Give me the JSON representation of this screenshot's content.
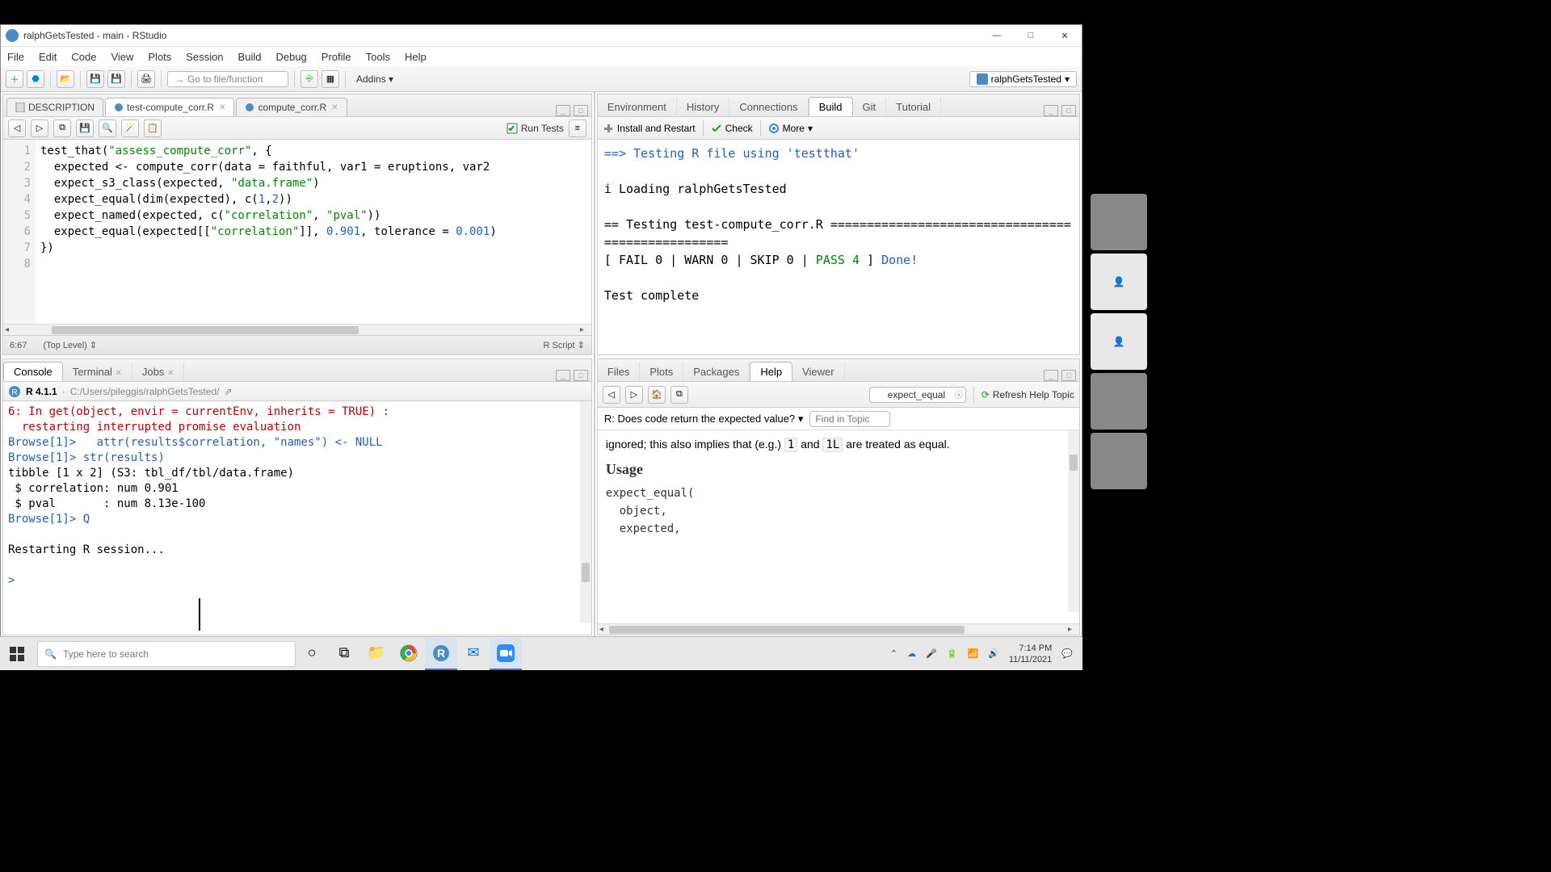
{
  "window": {
    "title": "ralphGetsTested - main - RStudio"
  },
  "menubar": [
    "File",
    "Edit",
    "Code",
    "View",
    "Plots",
    "Session",
    "Build",
    "Debug",
    "Profile",
    "Tools",
    "Help"
  ],
  "toolbar": {
    "goto_placeholder": "Go to file/function",
    "addins_label": "Addins",
    "project_label": "ralphGetsTested"
  },
  "source_tabs": [
    {
      "label": "DESCRIPTION",
      "active": false,
      "closable": false
    },
    {
      "label": "test-compute_corr.R",
      "active": true,
      "closable": true
    },
    {
      "label": "compute_corr.R",
      "active": false,
      "closable": true
    }
  ],
  "source_toolbar": {
    "runtests": "Run Tests"
  },
  "code_lines": {
    "l1_a": "test_that(",
    "l1_b": "\"assess_compute_corr\"",
    "l1_c": ", {",
    "l2_a": "  expected <- compute_corr(data = faithful, var1 = eruptions, var2",
    "l3_a": "  expect_s3_class(expected, ",
    "l3_b": "\"data.frame\"",
    "l3_c": ")",
    "l4_a": "  expect_equal(dim(expected), c(",
    "l4_b": "1",
    "l4_c": ",",
    "l4_d": "2",
    "l4_e": "))",
    "l5_a": "  expect_named(expected, c(",
    "l5_b": "\"correlation\"",
    "l5_c": ", ",
    "l5_d": "\"pval\"",
    "l5_e": "))",
    "l6_a": "  expect_equal(expected[[",
    "l6_b": "\"correlation\"",
    "l6_c": "]], ",
    "l6_d": "0.901",
    "l6_e": ", tolerance = ",
    "l6_f": "0.001",
    "l6_g": ")",
    "l7": "})",
    "l8": ""
  },
  "gutter": [
    "1",
    "2",
    "3",
    "4",
    "5",
    "6",
    "7",
    "8"
  ],
  "source_status": {
    "pos": "6:67",
    "scope": "(Top Level)",
    "lang": "R Script"
  },
  "console_tabs": [
    {
      "label": "Console",
      "active": true
    },
    {
      "label": "Terminal",
      "active": false,
      "closable": true
    },
    {
      "label": "Jobs",
      "active": false,
      "closable": true
    }
  ],
  "console_header": {
    "version": "R 4.1.1",
    "path": "C:/Users/pileggis/ralphGetsTested/"
  },
  "console_lines": {
    "c1": "6: In get(object, envir = currentEnv, inherits = TRUE) :",
    "c2": "  restarting interrupted promise evaluation",
    "c3a": "Browse[1]> ",
    "c3b": "  attr(results$correlation, \"names\") <- NULL",
    "c4a": "Browse[1]> ",
    "c4b": "str(results)",
    "c5": "tibble [1 x 2] (S3: tbl_df/tbl/data.frame)",
    "c6": " $ correlation: num 0.901",
    "c7": " $ pval       : num 8.13e-100",
    "c8a": "Browse[1]> ",
    "c8b": "Q",
    "c9": "",
    "c10": "Restarting R session...",
    "c11": "",
    "c12": "> "
  },
  "tr_tabs": [
    "Environment",
    "History",
    "Connections",
    "Build",
    "Git",
    "Tutorial"
  ],
  "tr_active": "Build",
  "build_toolbar": {
    "install": "Install and Restart",
    "check": "Check",
    "more": "More"
  },
  "build_lines": {
    "b1a": "==> ",
    "b1b": "Testing R file using 'testthat'",
    "b2": "",
    "b3": "i Loading ralphGetsTested",
    "b4": "",
    "b5": "== Testing test-compute_corr.R ==================================================",
    "b6a": "[ FAIL 0 | WARN 0 | SKIP 0 | ",
    "b6b": "PASS 4",
    "b6c": " ] ",
    "b6d": "Done!",
    "b7": "",
    "b8": "Test complete"
  },
  "br_tabs": [
    "Files",
    "Plots",
    "Packages",
    "Help",
    "Viewer"
  ],
  "br_active": "Help",
  "help_toolbar": {
    "search_value": "expect_equal",
    "refresh": "Refresh Help Topic"
  },
  "help_title": "R: Does code return the expected value?",
  "help_find_placeholder": "Find in Topic",
  "help_body": {
    "para_a": "ignored; this also implies that (e.g.) ",
    "para_b": "1",
    "para_c": " and ",
    "para_d": "1L",
    "para_e": " are treated as equal.",
    "usage_h": "Usage",
    "code1": "expect_equal(",
    "code2": "  object,",
    "code3": "  expected,"
  },
  "taskbar": {
    "search_placeholder": "Type here to search",
    "time": "7:14 PM",
    "date": "11/11/2021"
  }
}
